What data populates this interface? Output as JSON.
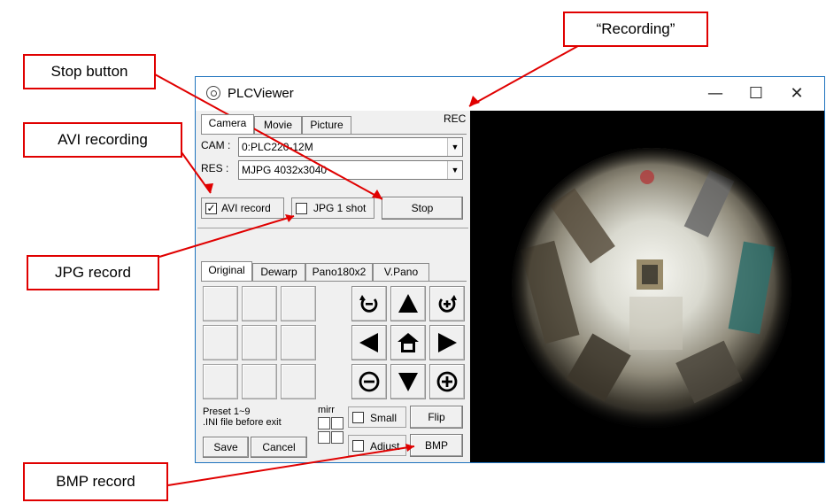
{
  "window": {
    "title": "PLCViewer",
    "minimize_glyph": "—",
    "maximize_glyph": "☐",
    "close_glyph": "✕"
  },
  "top_tabs": [
    "Camera",
    "Movie",
    "Picture"
  ],
  "rec_indicator": "REC",
  "camera": {
    "cam_label": "CAM :",
    "cam_value": "0:PLC220-12M",
    "res_label": "RES :",
    "res_value": "MJPG 4032x3040"
  },
  "record": {
    "avi_label": "AVI record",
    "avi_checked": true,
    "jpg_label": "JPG 1 shot",
    "jpg_checked": false,
    "stop_label": "Stop"
  },
  "view_tabs": [
    "Original",
    "Dewarp",
    "Pano180x2",
    "V.Pano"
  ],
  "controls": {
    "icons": [
      "rotate-ccw-icon",
      "arrow-up-icon",
      "rotate-cw-icon",
      "arrow-left-icon",
      "home-icon",
      "arrow-right-icon",
      "zoom-out-icon",
      "arrow-down-icon",
      "zoom-in-icon"
    ]
  },
  "preset": {
    "line1": "Preset 1~9",
    "line2": ".INI file before exit",
    "save_label": "Save",
    "cancel_label": "Cancel",
    "mirr_label": "mirr"
  },
  "options": {
    "small_label": "Small",
    "adjust_label": "Adjust",
    "flip_label": "Flip",
    "bmp_label": "BMP"
  },
  "callouts": {
    "recording": "“Recording”",
    "stop_button": "Stop button",
    "avi_recording": "AVI recording",
    "jpg_record": "JPG record",
    "bmp_record": "BMP record"
  },
  "colors": {
    "callout_red": "#e00000",
    "window_border": "#1e73be"
  }
}
